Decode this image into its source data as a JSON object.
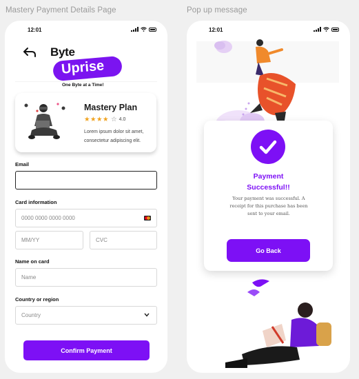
{
  "frames": {
    "left_title": "Mastery Payment Details Page",
    "right_title": "Pop up message"
  },
  "status_bar": {
    "time": "12:01"
  },
  "logo": {
    "word1": "Byte",
    "word2": "Uprise",
    "tagline": "One Byte at a Time!"
  },
  "plan": {
    "title": "Mastery Plan",
    "stars_filled": "★★★★",
    "star_empty": "☆",
    "rating": "4.0",
    "description": "Lorem ipsum dolor sit amet, consectetur adipiscing elit."
  },
  "form": {
    "email_label": "Email",
    "card_label": "Card information",
    "card_number_placeholder": "0000 0000 0000 0000",
    "expiry_placeholder": "MM/YY",
    "cvc_placeholder": "CVC",
    "name_label": "Name on card",
    "name_placeholder": "Name",
    "country_label": "Country or region",
    "country_value": "Country",
    "confirm_label": "Confirm Payment"
  },
  "popup": {
    "title_line1": "Payment",
    "title_line2": "Successful!!",
    "message": "Your payment was successful. A receipt for this purchase has been sent to your email.",
    "button_label": "Go Back"
  },
  "colors": {
    "accent": "#7d10f5",
    "star": "#f0a21e",
    "background": "#f0f0f0"
  },
  "icons": [
    "back-arrow-icon",
    "signal-icon",
    "wifi-icon",
    "battery-icon",
    "star-icon",
    "card-brand-icon",
    "chevron-down-icon",
    "checkmark-icon"
  ]
}
